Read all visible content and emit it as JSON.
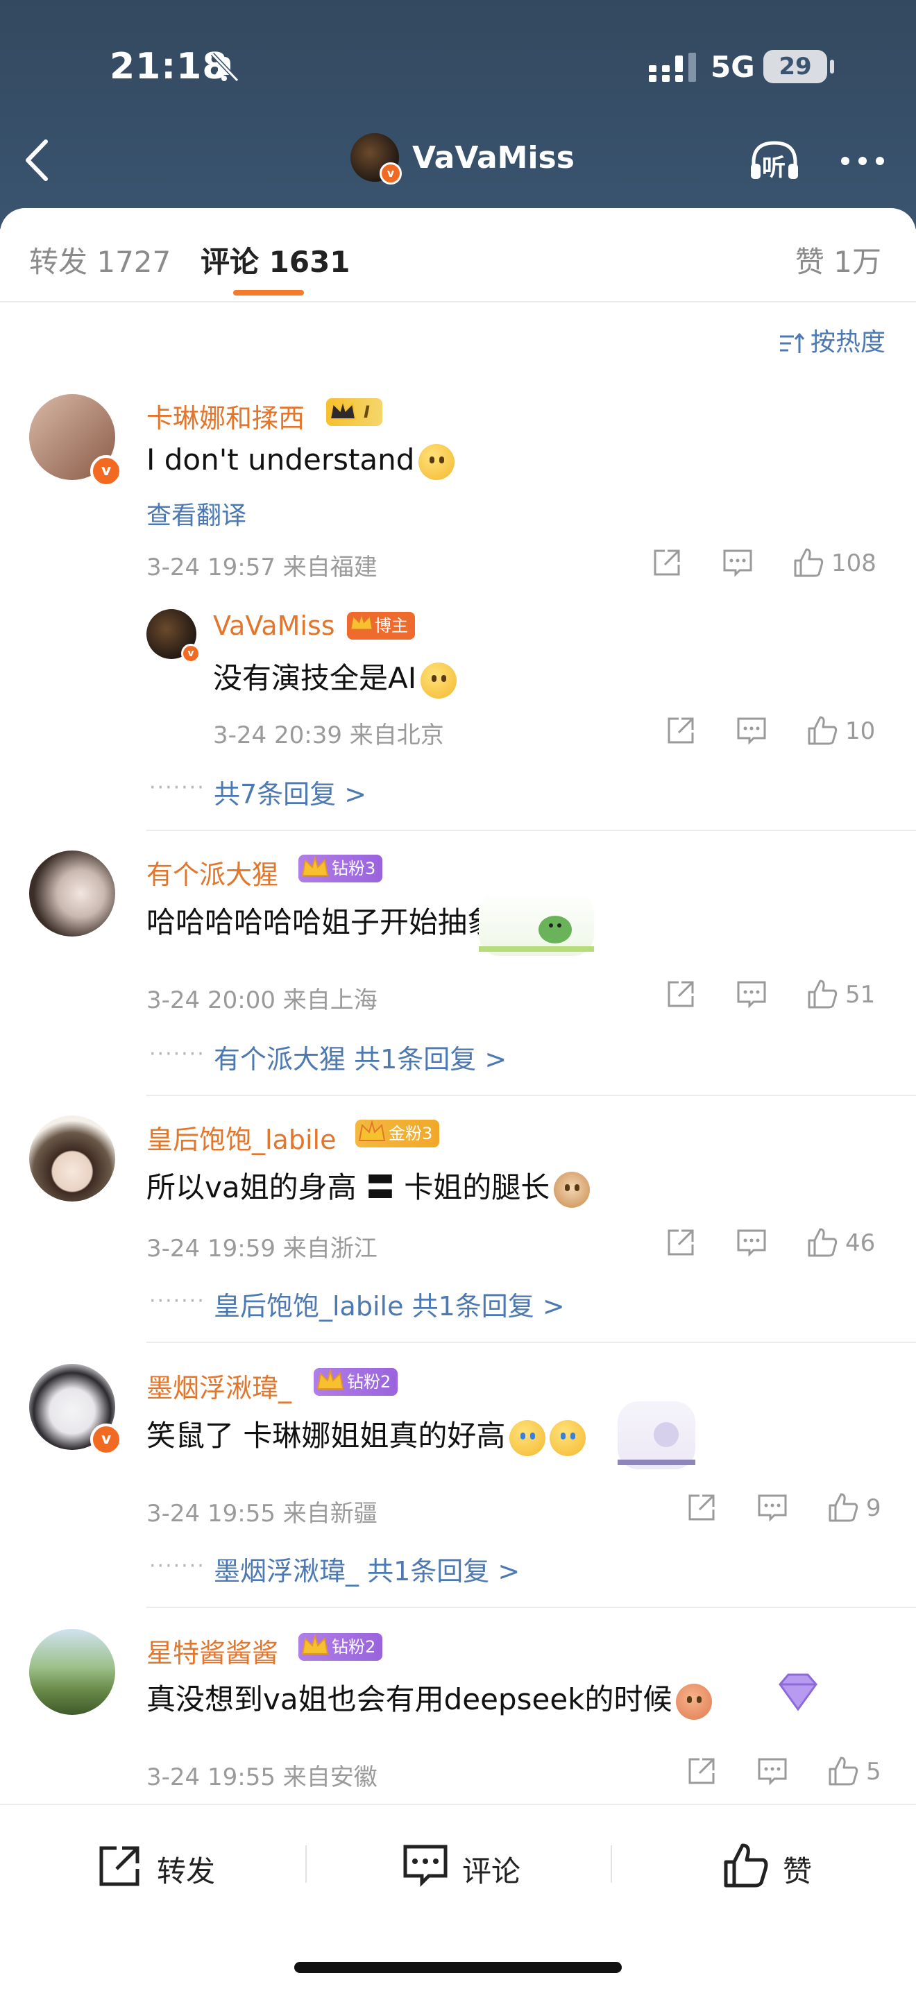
{
  "status": {
    "time": "21:18",
    "network": "5G",
    "battery": "29"
  },
  "nav": {
    "title": "VaVaMiss",
    "listen_label": "听"
  },
  "tabs": {
    "repost": "转发 1727",
    "comment": "评论 1631",
    "like": "赞 1万"
  },
  "sort": {
    "label": "按热度"
  },
  "comments": [
    {
      "username": "卡琳娜和揉西",
      "badge": "I",
      "text": "I don't understand",
      "translate": "查看翻译",
      "meta": "3-24 19:57  来自福建",
      "likes": "108",
      "sub_reply": {
        "username": "VaVaMiss",
        "badge": "博主",
        "text": "没有演技全是AI",
        "meta": "3-24 20:39  来自北京",
        "likes": "10"
      },
      "replies_link": "共7条回复 >"
    },
    {
      "username": "有个派大猩",
      "badge": "钻粉3",
      "text": "哈哈哈哈哈哈姐子开始抽象",
      "meta": "3-24 20:00  来自上海",
      "likes": "51",
      "replies_user": "有个派大猩",
      "replies_link": "共1条回复 >"
    },
    {
      "username": "皇后饱饱_labile",
      "badge": "金粉3",
      "text": "所以va姐的身高 〓 卡姐的腿长",
      "meta": "3-24 19:59  来自浙江",
      "likes": "46",
      "replies_user": "皇后饱饱_labile",
      "replies_link": "共1条回复 >"
    },
    {
      "username": "墨烟浮湫瑋_",
      "badge": "钻粉2",
      "text": "笑鼠了 卡琳娜姐姐真的好高",
      "meta": "3-24 19:55  来自新疆",
      "likes": "9",
      "replies_user": "墨烟浮湫瑋_",
      "replies_link": "共1条回复 >"
    },
    {
      "username": "星特酱酱酱",
      "badge": "钻粉2",
      "text": "真没想到va姐也会有用deepseek的时候",
      "meta": "3-24 19:55  来自安徽",
      "likes": "5"
    }
  ],
  "bottom": {
    "repost": "转发",
    "comment": "评论",
    "like": "赞"
  },
  "colors": {
    "header_bg": "#3a5470",
    "accent_orange": "#f47b2a",
    "username": "#e2762c",
    "link_blue": "#4d79b2"
  }
}
